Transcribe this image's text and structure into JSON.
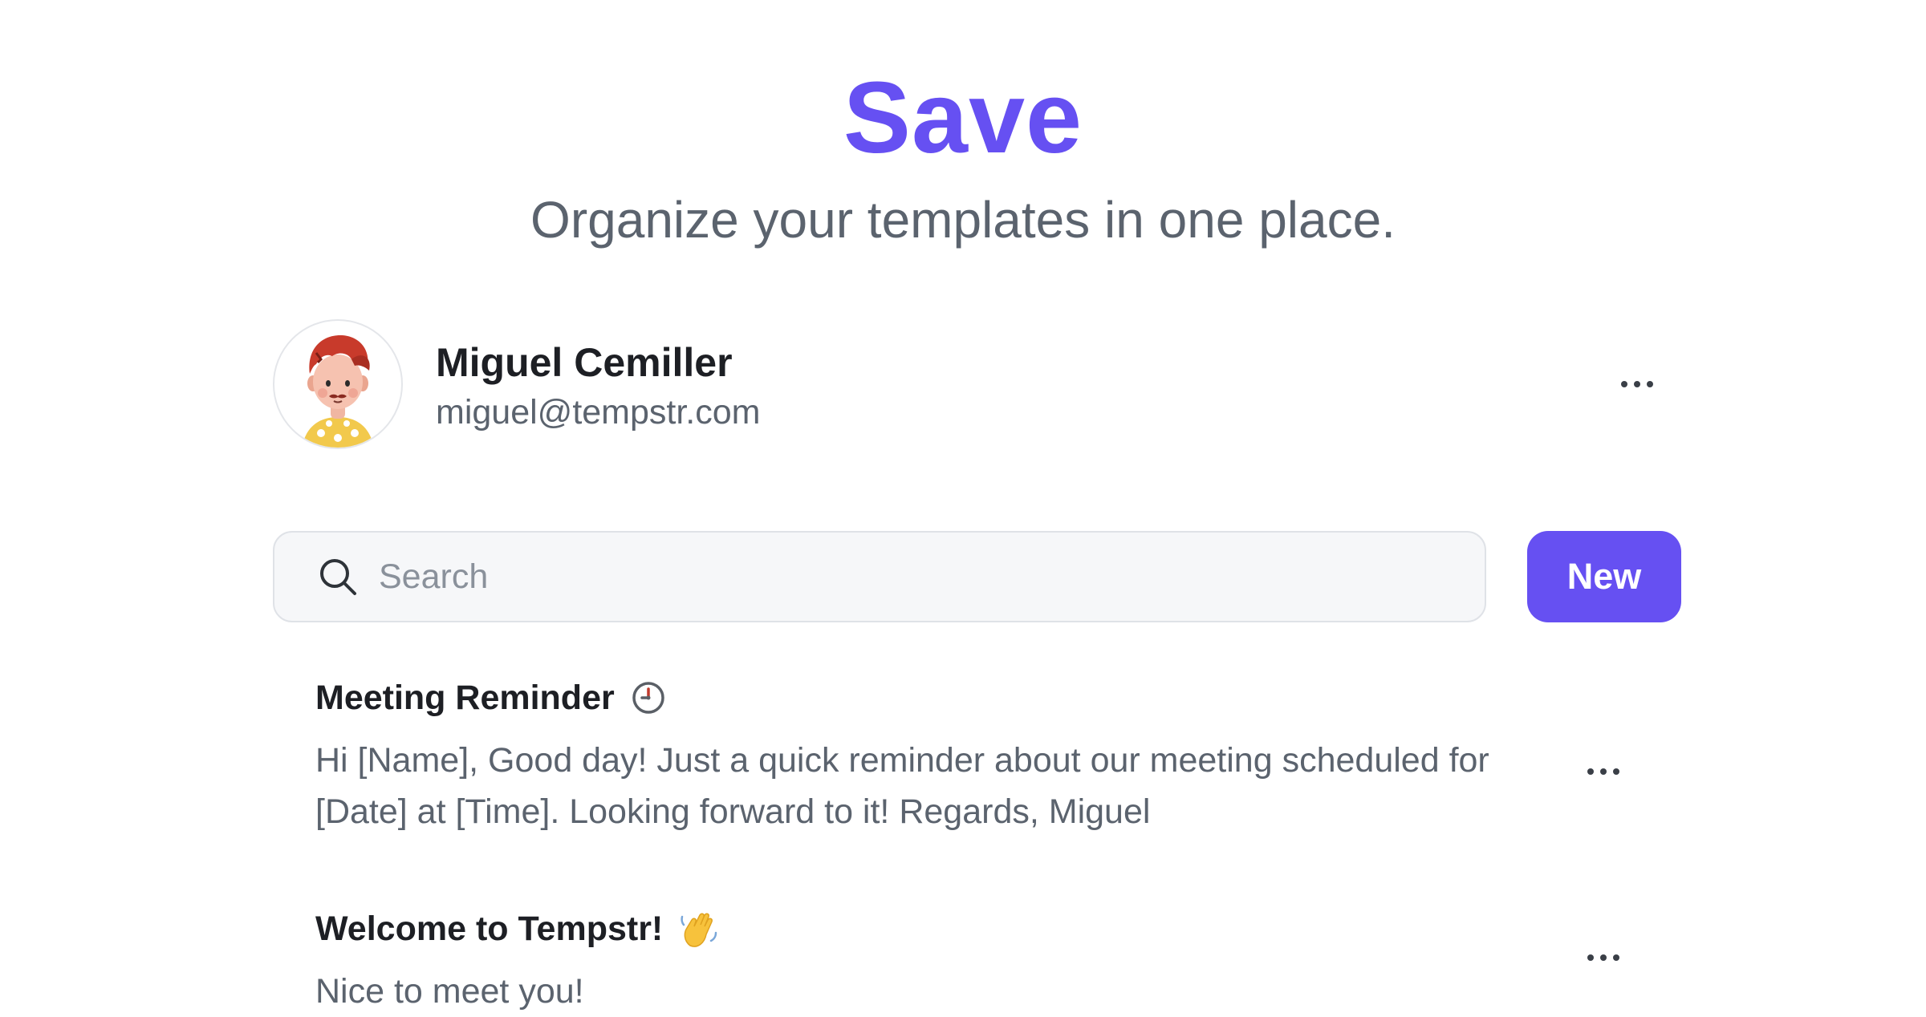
{
  "hero": {
    "title": "Save",
    "subtitle": "Organize your templates in one place."
  },
  "profile": {
    "name": "Miguel Cemiller",
    "email": "miguel@tempstr.com",
    "avatar_icon": "avatar-character-icon",
    "more_icon": "more-dots-icon"
  },
  "search": {
    "placeholder": "Search",
    "value": "",
    "icon": "search-icon"
  },
  "toolbar": {
    "new_label": "New"
  },
  "templates": [
    {
      "title": "Meeting Reminder",
      "icon": "clock-icon",
      "body": "Hi [Name], Good day! Just a quick reminder about our meeting scheduled for [Date] at [Time]. Looking forward to it! Regards, Miguel"
    },
    {
      "title": "Welcome to Tempstr!",
      "icon": "waving-hand-icon",
      "body": "Nice to meet you!"
    }
  ],
  "colors": {
    "accent": "#6650f2",
    "text_primary": "#1d1f24",
    "text_secondary": "#5b636e",
    "search_bg": "#f6f7f9"
  }
}
